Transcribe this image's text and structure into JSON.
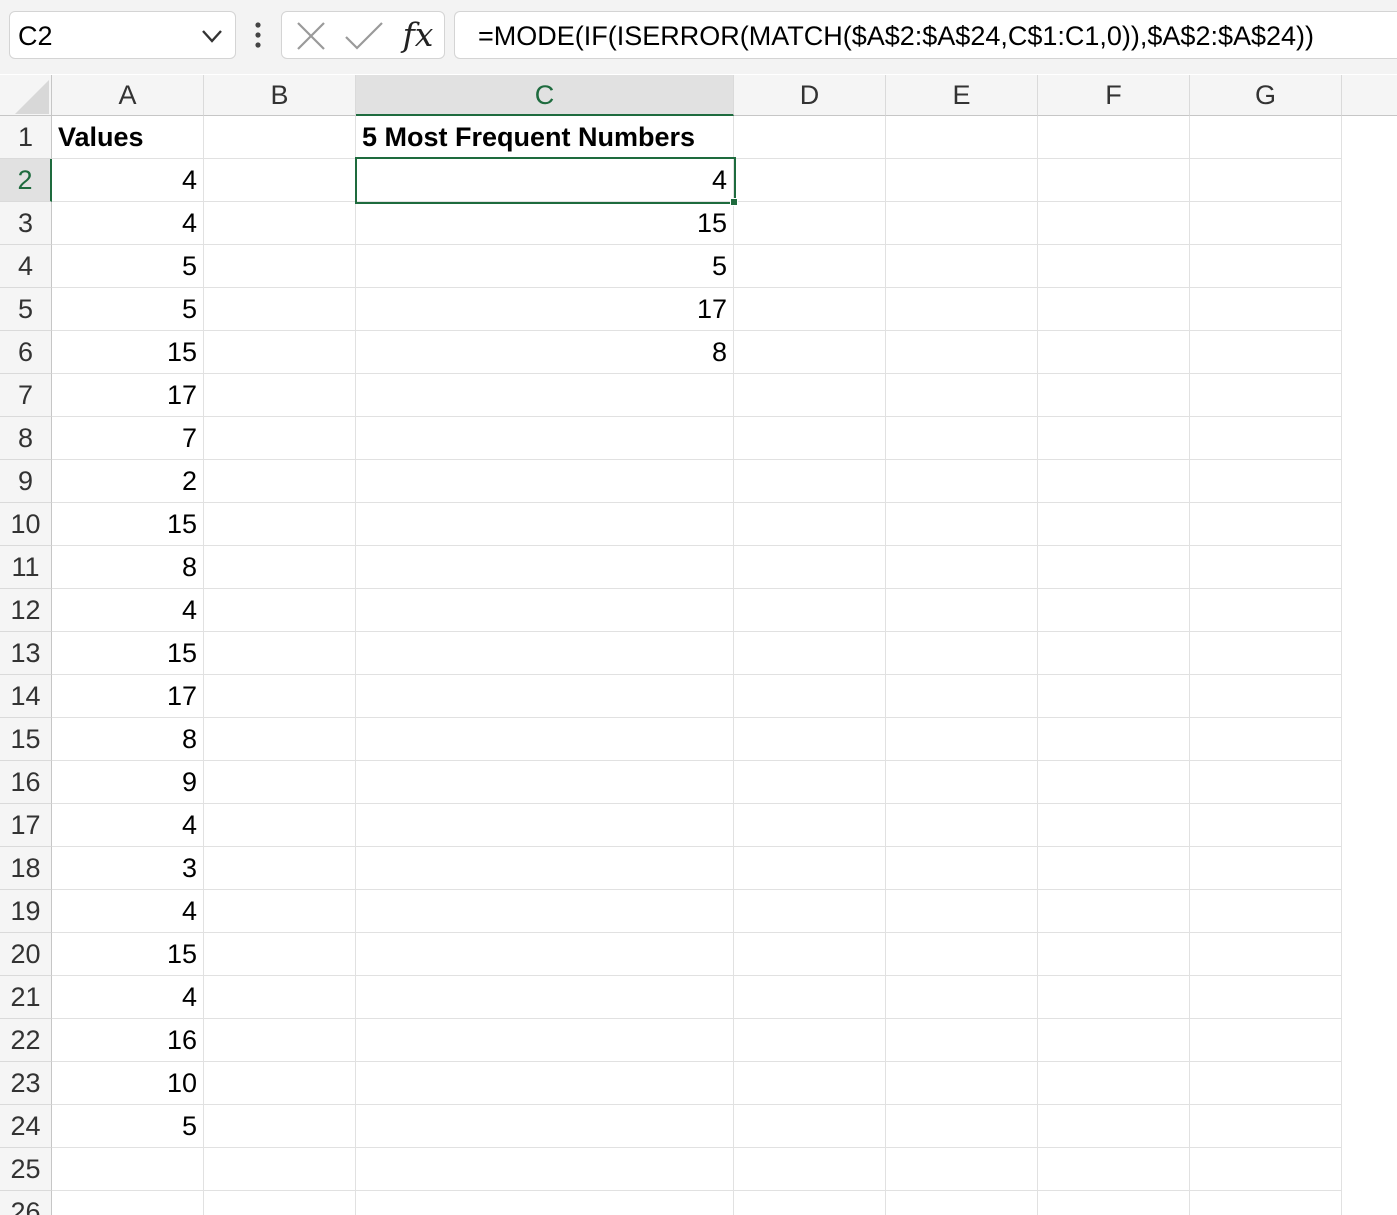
{
  "name_box": {
    "value": "C2"
  },
  "formula_bar": {
    "formula": "=MODE(IF(ISERROR(MATCH($A$2:$A$24,C$1:C1,0)),$A$2:$A$24))",
    "fx_label": "fx"
  },
  "columns": [
    "A",
    "B",
    "C",
    "D",
    "E",
    "F",
    "G"
  ],
  "selected_column": "C",
  "rows": [
    "1",
    "2",
    "3",
    "4",
    "5",
    "6",
    "7",
    "8",
    "9",
    "10",
    "11",
    "12",
    "13",
    "14",
    "15",
    "16",
    "17",
    "18",
    "19",
    "20",
    "21",
    "22",
    "23",
    "24",
    "25",
    "26"
  ],
  "selected_row": "2",
  "column_a": {
    "header": "Values",
    "values": [
      "4",
      "4",
      "5",
      "5",
      "15",
      "17",
      "7",
      "2",
      "15",
      "8",
      "4",
      "15",
      "17",
      "8",
      "9",
      "4",
      "3",
      "4",
      "15",
      "4",
      "16",
      "10",
      "5"
    ]
  },
  "column_c": {
    "header": "5 Most Frequent Numbers",
    "values": [
      "4",
      "15",
      "5",
      "17",
      "8"
    ]
  },
  "accent_color": "#1e6b3e"
}
